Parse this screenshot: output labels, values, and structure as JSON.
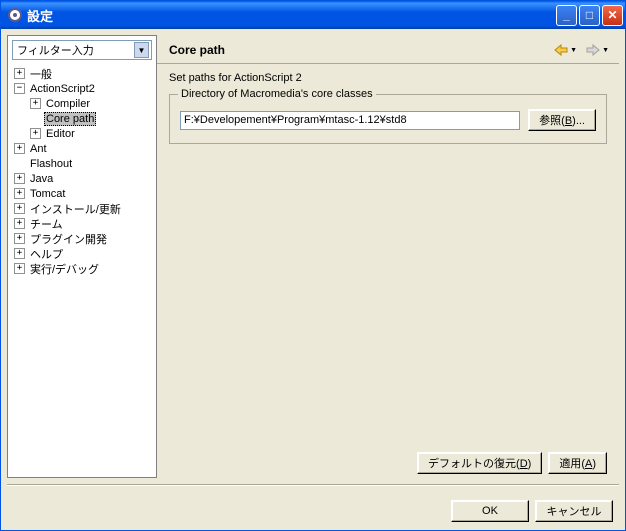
{
  "window": {
    "title": "設定"
  },
  "filter": {
    "placeholder": "フィルター入力"
  },
  "tree": {
    "items": [
      {
        "label": "一般",
        "indent": 0,
        "exp": "+"
      },
      {
        "label": "ActionScript2",
        "indent": 0,
        "exp": "-"
      },
      {
        "label": "Compiler",
        "indent": 1,
        "exp": "+"
      },
      {
        "label": "Core path",
        "indent": 1,
        "exp": "",
        "selected": true
      },
      {
        "label": "Editor",
        "indent": 1,
        "exp": "+"
      },
      {
        "label": "Ant",
        "indent": 0,
        "exp": "+"
      },
      {
        "label": "Flashout",
        "indent": 0,
        "exp": ""
      },
      {
        "label": "Java",
        "indent": 0,
        "exp": "+"
      },
      {
        "label": "Tomcat",
        "indent": 0,
        "exp": "+"
      },
      {
        "label": "インストール/更新",
        "indent": 0,
        "exp": "+"
      },
      {
        "label": "チーム",
        "indent": 0,
        "exp": "+"
      },
      {
        "label": "プラグイン開発",
        "indent": 0,
        "exp": "+"
      },
      {
        "label": "ヘルプ",
        "indent": 0,
        "exp": "+"
      },
      {
        "label": "実行/デバッグ",
        "indent": 0,
        "exp": "+"
      }
    ]
  },
  "page": {
    "heading": "Core path",
    "description": "Set paths for ActionScript 2",
    "group_label": "Directory of Macromedia's core classes",
    "path_value": "F:¥Developement¥Program¥mtasc-1.12¥std8",
    "browse_label": "参照",
    "browse_accel": "B",
    "restore_label": "デフォルトの復元",
    "restore_accel": "D",
    "apply_label": "適用",
    "apply_accel": "A"
  },
  "footer": {
    "ok": "OK",
    "cancel": "キャンセル"
  }
}
